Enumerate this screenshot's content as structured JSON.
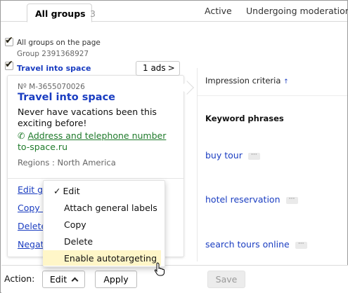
{
  "tabs": {
    "all_groups_label": "All groups",
    "all_groups_count": "3",
    "active_label": "Active",
    "moderation_label": "Undergoing moderation"
  },
  "selection": {
    "all_groups_label": "All groups on the page",
    "group_id": "Group 2391368927",
    "group_name": "Travel into space",
    "ads_count_label": "1 ads"
  },
  "ad": {
    "number": "Nº M-3655070026",
    "title": "Travel into space",
    "text_line1": "Never have vacations been this",
    "text_line2": "exciting before!",
    "contact_link": "Address and telephone number",
    "domain": "to-space.ru",
    "regions": "Regions : North America"
  },
  "group_actions": {
    "edit": "Edit gr",
    "copy": "Copy g",
    "delete": "Delete",
    "negative": "Negat"
  },
  "dropdown": {
    "items": [
      {
        "label": "Edit",
        "checked": true
      },
      {
        "label": "Attach general labels"
      },
      {
        "label": "Copy"
      },
      {
        "label": "Delete"
      },
      {
        "label": "Enable autotargeting",
        "highlighted": true
      }
    ]
  },
  "right_panel": {
    "impression_criteria": "Impression criteria",
    "sort_arrow": "↑",
    "keyword_phrases": "Keyword phrases",
    "phrases": [
      "buy tour",
      "hotel reservation",
      "search tours online"
    ],
    "more_glyph": "···"
  },
  "bottom_bar": {
    "action_label": "Action:",
    "edit_button": "Edit",
    "apply_button": "Apply",
    "save_button": "Save"
  },
  "colors": {
    "link_blue": "#1a3dc1",
    "contact_green": "#1e7a2a",
    "checkbox_yellow": "#f5c400",
    "highlight": "#fff6c8"
  }
}
